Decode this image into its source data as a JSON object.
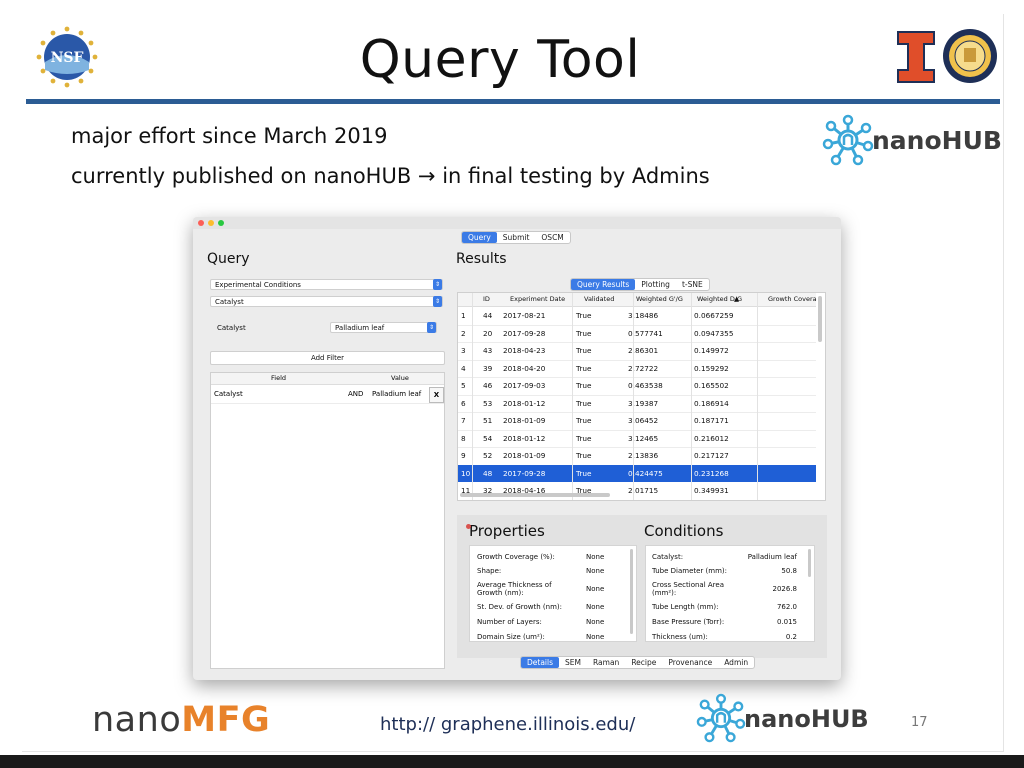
{
  "slide": {
    "title": "Query Tool",
    "bullets": [
      "major effort since March 2019",
      "currently published on nanoHUB → in final testing by Admins"
    ],
    "nsf_logo_text": "NSF",
    "footer_brand_nano": "nano",
    "footer_brand_mfg": "MFG",
    "footer_url": "http:// graphene.illinois.edu/",
    "nanohub_label": "nanoHUB",
    "page_number": "17"
  },
  "app": {
    "top_tabs": [
      "Query",
      "Submit",
      "OSCM"
    ],
    "query": {
      "title": "Query",
      "dropdown_1": "Experimental Conditions",
      "dropdown_2": "Catalyst",
      "field_label": "Catalyst",
      "field_value": "Palladium leaf",
      "add_filter_label": "Add Filter",
      "filter_table": {
        "headers": [
          "Field",
          "Value"
        ],
        "rows": [
          {
            "field": "Catalyst",
            "op": "AND",
            "value": "Palladium leaf",
            "remove": "X"
          }
        ]
      }
    },
    "results": {
      "title": "Results",
      "tabs": [
        "Query Results",
        "Plotting",
        "t-SNE"
      ],
      "columns": [
        "ID",
        "Experiment Date",
        "Validated",
        "Weighted G'/G",
        "Weighted D/G",
        "Growth Covera"
      ],
      "sort_indicator": "▲",
      "rows": [
        {
          "n": "1",
          "id": "44",
          "date": "2017-08-21",
          "valid": "True",
          "g": "3.18486",
          "d": "0.0667259"
        },
        {
          "n": "2",
          "id": "20",
          "date": "2017-09-28",
          "valid": "True",
          "g": "0.577741",
          "d": "0.0947355"
        },
        {
          "n": "3",
          "id": "43",
          "date": "2018-04-23",
          "valid": "True",
          "g": "2.86301",
          "d": "0.149972"
        },
        {
          "n": "4",
          "id": "39",
          "date": "2018-04-20",
          "valid": "True",
          "g": "2.72722",
          "d": "0.159292"
        },
        {
          "n": "5",
          "id": "46",
          "date": "2017-09-03",
          "valid": "True",
          "g": "0.463538",
          "d": "0.165502"
        },
        {
          "n": "6",
          "id": "53",
          "date": "2018-01-12",
          "valid": "True",
          "g": "3.19387",
          "d": "0.186914"
        },
        {
          "n": "7",
          "id": "51",
          "date": "2018-01-09",
          "valid": "True",
          "g": "3.06452",
          "d": "0.187171"
        },
        {
          "n": "8",
          "id": "54",
          "date": "2018-01-12",
          "valid": "True",
          "g": "3.12465",
          "d": "0.216012"
        },
        {
          "n": "9",
          "id": "52",
          "date": "2018-01-09",
          "valid": "True",
          "g": "2.13836",
          "d": "0.217127"
        },
        {
          "n": "10",
          "id": "48",
          "date": "2017-09-28",
          "valid": "True",
          "g": "0.424475",
          "d": "0.231268"
        },
        {
          "n": "11",
          "id": "32",
          "date": "2018-04-16",
          "valid": "True",
          "g": "2.01715",
          "d": "0.349931"
        }
      ],
      "selected_row_number": "10"
    },
    "properties": {
      "title": "Properties",
      "items": [
        {
          "label": "Growth Coverage (%):",
          "value": "None"
        },
        {
          "label": "Shape:",
          "value": "None"
        },
        {
          "label": "Average Thickness of Growth (nm):",
          "value": "None"
        },
        {
          "label": "St. Dev. of Growth (nm):",
          "value": "None"
        },
        {
          "label": "Number of Layers:",
          "value": "None"
        },
        {
          "label": "Domain Size (um²):",
          "value": "None"
        }
      ]
    },
    "conditions": {
      "title": "Conditions",
      "items": [
        {
          "label": "Catalyst:",
          "value": "Palladium leaf"
        },
        {
          "label": "Tube Diameter (mm):",
          "value": "50.8"
        },
        {
          "label": "Cross Sectional Area (mm²):",
          "value": "2026.8"
        },
        {
          "label": "Tube Length (mm):",
          "value": "762.0"
        },
        {
          "label": "Base Pressure (Torr):",
          "value": "0.015"
        },
        {
          "label": "Thickness (um):",
          "value": "0.2"
        }
      ]
    },
    "bottom_tabs": [
      "Details",
      "SEM",
      "Raman",
      "Recipe",
      "Provenance",
      "Admin"
    ]
  },
  "colors": {
    "rule": "#2b5c94",
    "accent_blue": "#3b7be6",
    "selection": "#1f5fd6",
    "mfg_orange": "#e8822a",
    "illinois_orange": "#e04e2a",
    "nanohub_blue": "#3aa7d8"
  }
}
